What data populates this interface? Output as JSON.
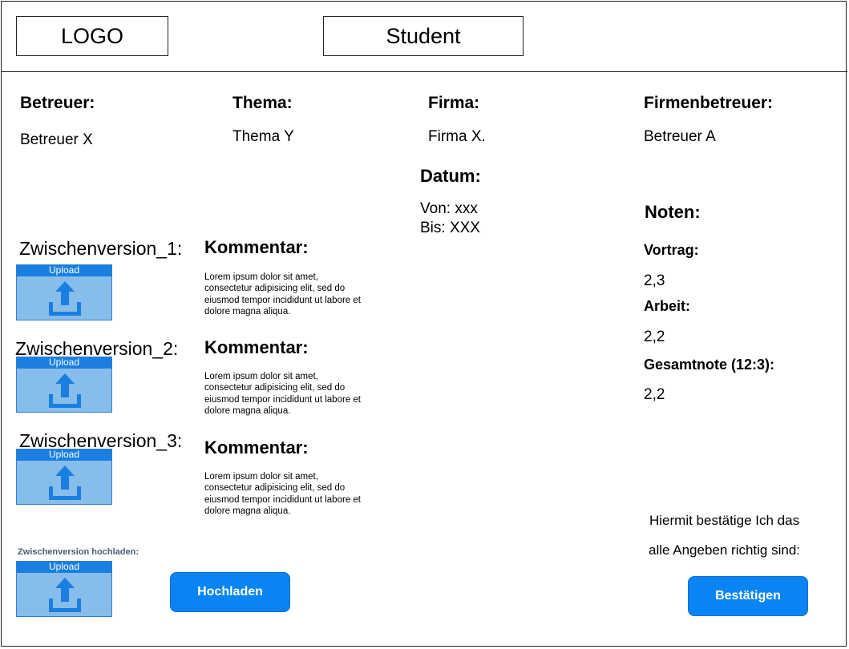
{
  "header": {
    "logo": "LOGO",
    "title": "Student"
  },
  "info": {
    "betreuer_label": "Betreuer:",
    "betreuer_value": "Betreuer X",
    "thema_label": "Thema:",
    "thema_value": "Thema Y",
    "firma_label": "Firma:",
    "firma_value": "Firma X.",
    "firmenbetreuer_label": "Firmenbetreuer:",
    "firmenbetreuer_value": "Betreuer A",
    "datum_label": "Datum:",
    "von": "Von: xxx",
    "bis": "Bis: XXX"
  },
  "noten": {
    "label": "Noten:",
    "vortrag_label": "Vortrag:",
    "vortrag_value": "2,3",
    "arbeit_label": "Arbeit:",
    "arbeit_value": "2,2",
    "gesamt_label": "Gesamtnote (12:3):",
    "gesamt_value": "2,2"
  },
  "versions": [
    {
      "label": "Zwischenversion_1:",
      "upload": "Upload",
      "kommentar_label": "Kommentar:",
      "kommentar": "Lorem ipsum dolor sit amet, consectetur adipisicing elit, sed do eiusmod tempor incididunt ut labore et dolore magna aliqua."
    },
    {
      "label": "Zwischenversion_2:",
      "upload": "Upload",
      "kommentar_label": "Kommentar:",
      "kommentar": "Lorem ipsum dolor sit amet, consectetur adipisicing elit, sed do eiusmod tempor incididunt ut labore et dolore magna aliqua."
    },
    {
      "label": "Zwischenversion_3:",
      "upload": "Upload",
      "kommentar_label": "Kommentar:",
      "kommentar": "Lorem ipsum dolor sit amet, consectetur adipisicing elit, sed do eiusmod tempor incididunt ut labore et dolore magna aliqua."
    }
  ],
  "new_upload": {
    "label": "Zwischenversion hochladen:",
    "upload": "Upload",
    "button": "Hochladen"
  },
  "confirm": {
    "line1": "Hiermit bestätige Ich das",
    "line2": "alle Angeben richtig sind:",
    "button": "Bestätigen"
  },
  "colors": {
    "accent": "#0a84f3",
    "upload_fill": "#86bdea",
    "upload_bar": "#1a7fe0"
  },
  "icons": {
    "upload": "upload-arrow-icon"
  }
}
